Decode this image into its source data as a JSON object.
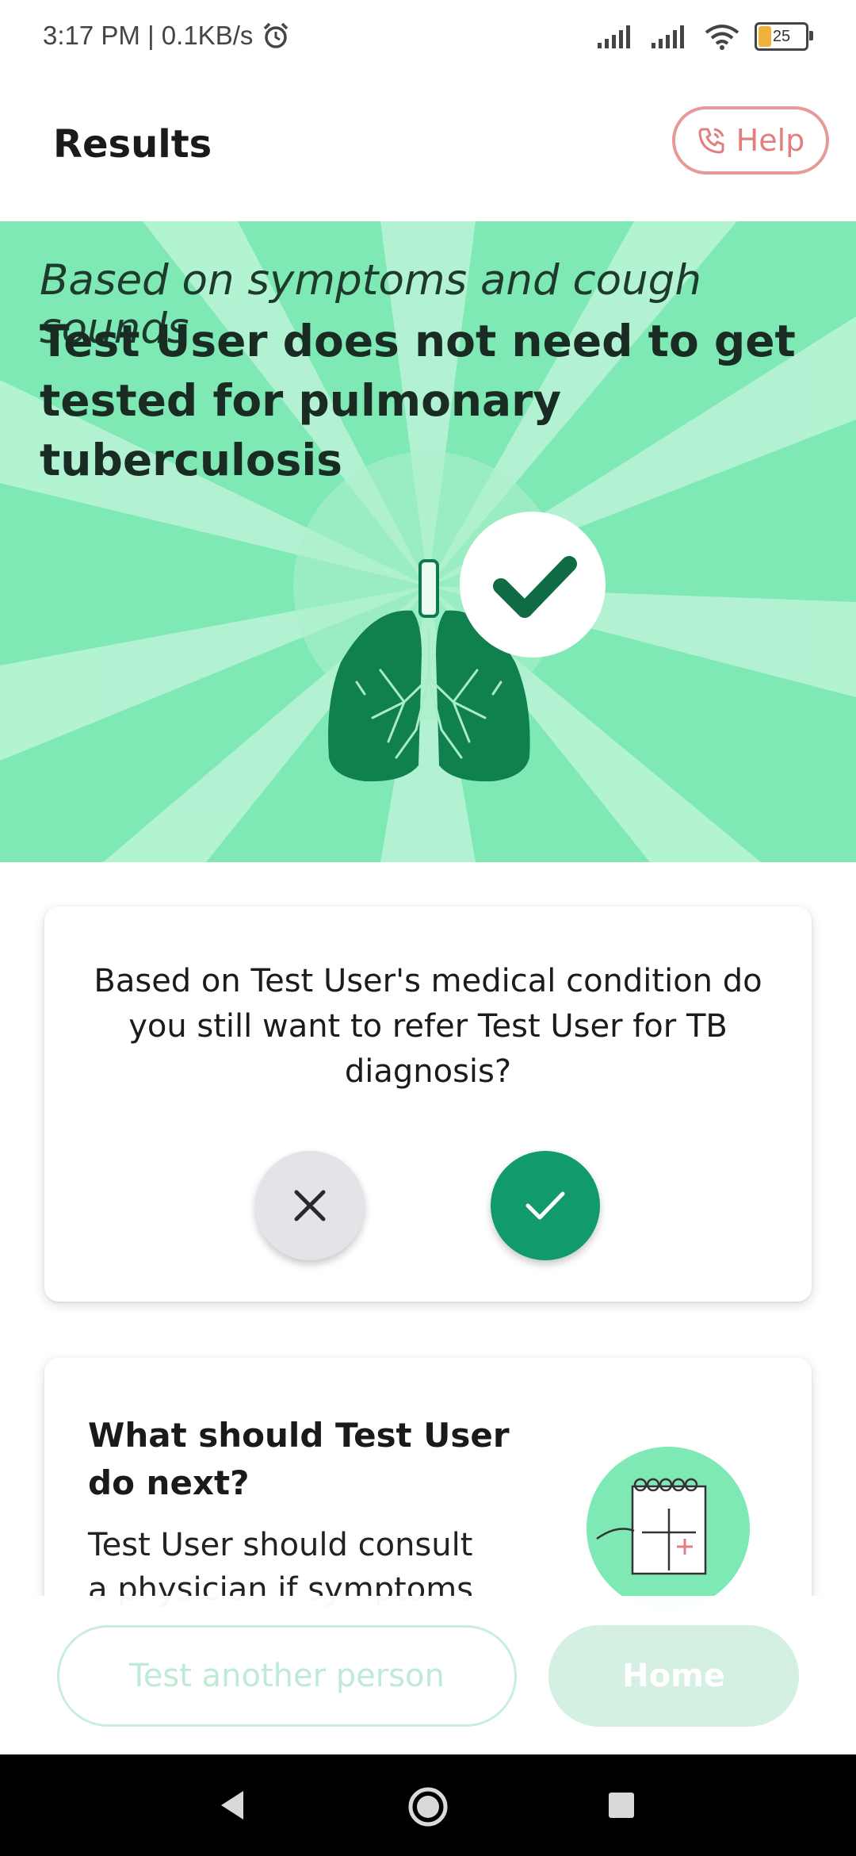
{
  "status_bar": {
    "time_speed": "3:17 PM | 0.1KB/s",
    "battery_level": "25",
    "icons": [
      "alarm-icon",
      "signal-icon",
      "signal-icon",
      "wifi-icon",
      "battery-icon"
    ]
  },
  "header": {
    "title": "Results",
    "help_label": "Help",
    "help_icon": "phone-icon",
    "help_color": "#e07f7f"
  },
  "hero": {
    "subtitle": "Based on symptoms and cough sounds",
    "result": "Test User does not need to get tested for pulmonary tuberculosis",
    "background_color": "#7ee9b5",
    "illustration": "lungs-check-icon"
  },
  "referral_card": {
    "question": "Based on Test User's medical condition do you still want to refer Test User for TB diagnosis?",
    "no_icon": "close-icon",
    "yes_icon": "check-icon",
    "yes_color": "#129a6f"
  },
  "next_card": {
    "title": "What should Test User do next?",
    "body": "Test User should consult a physician if symptoms",
    "illustration": "calendar-icon"
  },
  "actions": {
    "test_another": "Test another person",
    "home": "Home"
  },
  "nav_bar": {
    "icons": [
      "back-icon",
      "home-icon",
      "recent-apps-icon"
    ]
  }
}
